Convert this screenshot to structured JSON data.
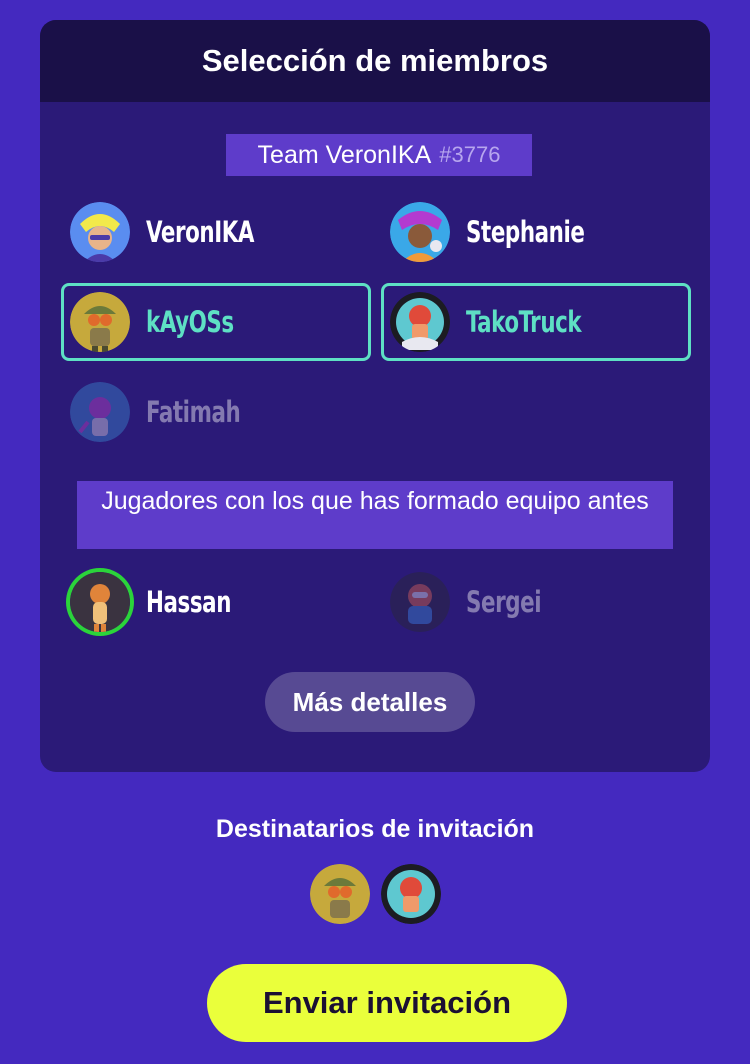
{
  "header": {
    "title": "Selección de miembros"
  },
  "team": {
    "name": "Team VeronIKA",
    "code": "#3776"
  },
  "members": [
    {
      "name": "VeronIKA",
      "state": "normal",
      "avatar_colors": [
        "#5a8df0",
        "#f2e94a",
        "#4b3aa8"
      ]
    },
    {
      "name": "Stephanie",
      "state": "normal",
      "avatar_colors": [
        "#3aa8e8",
        "#b33ad0",
        "#f09a3a"
      ]
    },
    {
      "name": "kAyOSs",
      "state": "selected",
      "avatar_colors": [
        "#c6a93c",
        "#e06a2c",
        "#6b7a3a"
      ]
    },
    {
      "name": "TakoTruck",
      "state": "selected",
      "avatar_colors": [
        "#1c1c22",
        "#e04a3a",
        "#5ec8d0"
      ]
    },
    {
      "name": "Fatimah",
      "state": "dim",
      "avatar_colors": [
        "#3a8ad0",
        "#c64ad0",
        "#e0e0f0"
      ]
    }
  ],
  "previous": {
    "label": "Jugadores con los que has formado equipo antes",
    "players": [
      {
        "name": "Hassan",
        "state": "online",
        "avatar_colors": [
          "#3a3340",
          "#e0843a",
          "#f0c07a"
        ]
      },
      {
        "name": "Sergei",
        "state": "dim",
        "avatar_colors": [
          "#2a2a30",
          "#3a8ad0",
          "#e06a3a"
        ]
      }
    ]
  },
  "more_button": "Más detalles",
  "recipients": {
    "title": "Destinatarios de invitación",
    "avatars": [
      "kAyOSs",
      "TakoTruck"
    ]
  },
  "send_button": "Enviar invitación",
  "colors": {
    "background": "#4429bf",
    "card": "#2b1a78",
    "header": "#1a1048",
    "selected": "#5ee0c4",
    "accent_button": "#eaff3b"
  }
}
